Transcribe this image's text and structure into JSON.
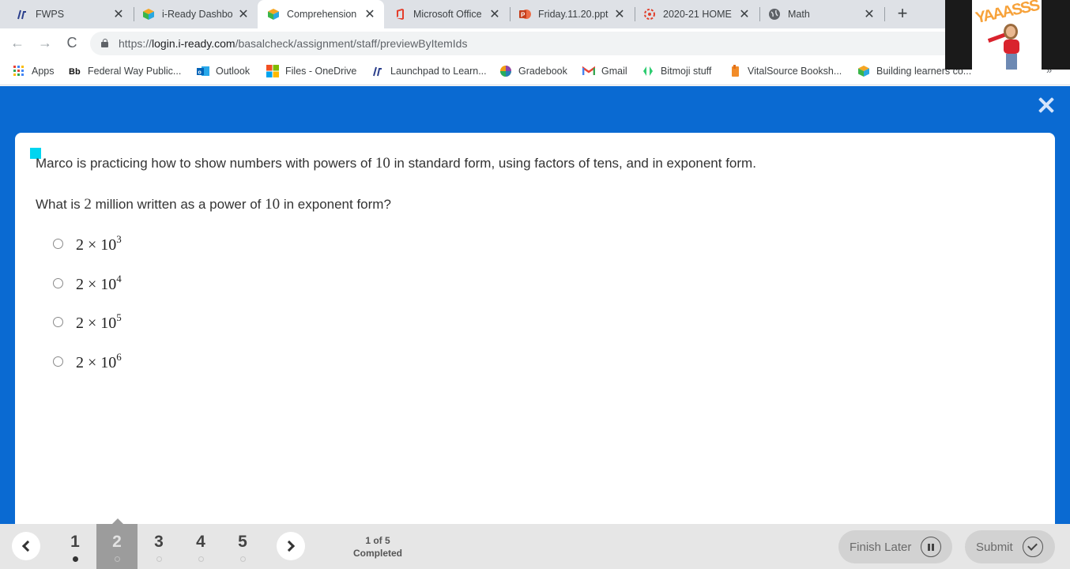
{
  "browser": {
    "tabs": [
      {
        "title": "FWPS",
        "icon": "fwps-logo-icon",
        "active": false
      },
      {
        "title": "i-Ready Dashbo",
        "icon": "iready-cube-icon",
        "active": false
      },
      {
        "title": "Comprehension",
        "icon": "iready-cube-icon",
        "active": true
      },
      {
        "title": "Microsoft Office",
        "icon": "office-icon",
        "active": false
      },
      {
        "title": "Friday.11.20.ppt",
        "icon": "powerpoint-icon",
        "active": false
      },
      {
        "title": "2020-21 HOME",
        "icon": "canvas-icon",
        "active": false
      },
      {
        "title": "Math",
        "icon": "globe-icon",
        "active": false
      }
    ],
    "tab_close_glyph": "✕",
    "new_tab_glyph": "+",
    "nav": {
      "back": "←",
      "forward": "→",
      "reload": "C"
    },
    "url": {
      "scheme": "https://",
      "host": "login.i-ready.com",
      "path": "/basalcheck/assignment/staff/previewByItemIds"
    },
    "bookmarks": [
      {
        "label": "Apps",
        "icon": "apps-grid-icon"
      },
      {
        "label": "Federal Way Public...",
        "icon": "blackboard-icon"
      },
      {
        "label": "Outlook",
        "icon": "outlook-icon"
      },
      {
        "label": "Files - OneDrive",
        "icon": "microsoft-icon"
      },
      {
        "label": "Launchpad to Learn...",
        "icon": "fwps-logo-icon"
      },
      {
        "label": "Gradebook",
        "icon": "gradebook-icon"
      },
      {
        "label": "Gmail",
        "icon": "gmail-icon"
      },
      {
        "label": "Bitmoji stuff",
        "icon": "bitmoji-icon"
      },
      {
        "label": "VitalSource Booksh...",
        "icon": "vitalsource-icon"
      },
      {
        "label": "Building learners co...",
        "icon": "iready-cube-icon"
      }
    ],
    "more_bookmarks_glyph": "»"
  },
  "overlay": {
    "sticker_text": "YAAASSS"
  },
  "colors": {
    "app_blue": "#0a6ad2",
    "focus_cyan": "#00d5f0",
    "bottom_bar": "#e6e6e6"
  },
  "question": {
    "passage": {
      "before": "Marco is practicing how to show numbers with powers of ",
      "num": "10",
      "after": " in standard form, using factors of tens, and in exponent form."
    },
    "prompt": {
      "p1": "What is ",
      "n1": "2",
      "p2": " million written as a power of ",
      "n2": "10",
      "p3": " in exponent form?"
    },
    "choices": [
      {
        "base": "2 × 10",
        "exponent": "3",
        "selected": false
      },
      {
        "base": "2 × 10",
        "exponent": "4",
        "selected": false
      },
      {
        "base": "2 × 10",
        "exponent": "5",
        "selected": false
      },
      {
        "base": "2 × 10",
        "exponent": "6",
        "selected": false
      }
    ]
  },
  "footer": {
    "questions": [
      {
        "number": "1",
        "completed": true,
        "current": false
      },
      {
        "number": "2",
        "completed": false,
        "current": true
      },
      {
        "number": "3",
        "completed": false,
        "current": false
      },
      {
        "number": "4",
        "completed": false,
        "current": false
      },
      {
        "number": "5",
        "completed": false,
        "current": false
      }
    ],
    "progress_count": "1 of 5",
    "progress_label": "Completed",
    "finish_later_label": "Finish Later",
    "submit_label": "Submit"
  }
}
